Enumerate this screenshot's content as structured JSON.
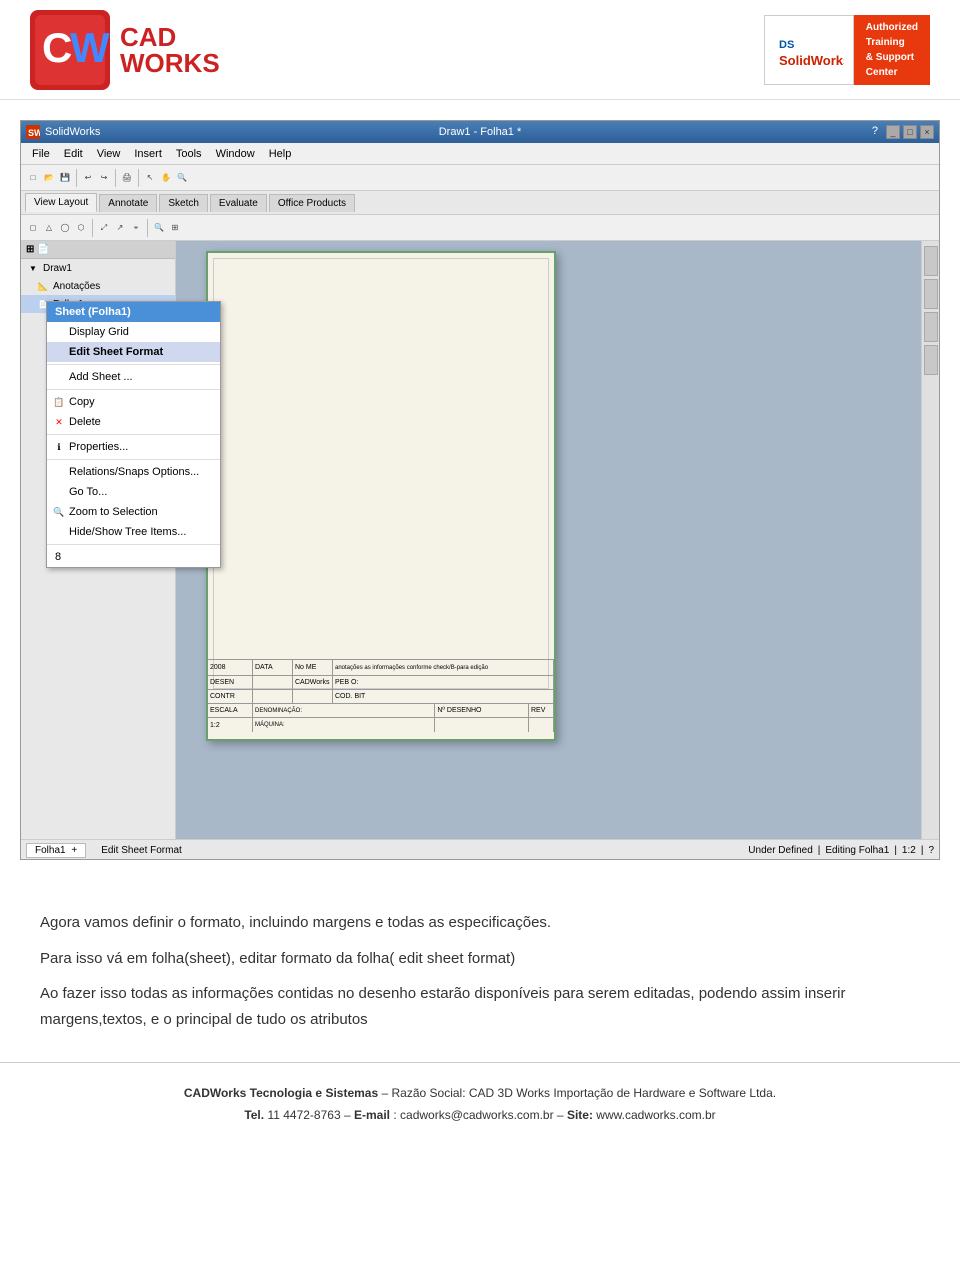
{
  "header": {
    "logo_text_line1": "CAD",
    "logo_text_line2": "WORKS",
    "solidworks_label": "SolidWorks",
    "authorized_line1": "Authorized",
    "authorized_line2": "Training",
    "authorized_line3": "& Support",
    "authorized_line4": "Center"
  },
  "solidworks_app": {
    "title": "Draw1 - Folha1 *",
    "app_name": "SolidWorks",
    "menu_items": [
      "View Layout",
      "Annotate",
      "Sketch",
      "Evaluate",
      "Office Products"
    ],
    "tabs": {
      "labels": [
        "View Layout",
        "Annotate",
        "Sketch",
        "Evaluate",
        "Office Products"
      ]
    },
    "tree": {
      "draw_label": "Draw1",
      "annotations_label": "Anotações",
      "sheet_label": "Sheet (Folha1)"
    },
    "context_menu": {
      "header": "Sheet (Folha1)",
      "items": [
        {
          "label": "Display Grid",
          "icon": ""
        },
        {
          "label": "Edit Sheet Format",
          "icon": ""
        },
        {
          "label": "Add Sheet ...",
          "icon": ""
        },
        {
          "label": "Copy",
          "icon": "copy"
        },
        {
          "label": "Delete",
          "icon": "x"
        },
        {
          "label": "Properties...",
          "icon": "props"
        },
        {
          "label": "Relations/Snaps Options...",
          "icon": ""
        },
        {
          "label": "Go To...",
          "icon": ""
        },
        {
          "label": "Zoom to Selection",
          "icon": "zoom"
        },
        {
          "label": "Hide/Show Tree Items...",
          "icon": ""
        },
        {
          "label": "8",
          "icon": ""
        }
      ]
    },
    "titleblock": {
      "row1": [
        "2008",
        "DATA",
        "No ME",
        "anotações as informações conforme check/B-para edição"
      ],
      "row2": [
        "DESEN",
        "",
        "CADWorks",
        "PEB O:"
      ],
      "row3": [
        "CONTR",
        "",
        "",
        "COD. BIT"
      ],
      "row4": [
        "ESCALA",
        "DENOMINAÇÃO:",
        "",
        "Nº DESENHO",
        "REV"
      ],
      "row5": [
        "1:2",
        "MÁQUINA:",
        "",
        "",
        ""
      ]
    },
    "status": {
      "sheet_tab": "Folha1",
      "status_text": "Edit Sheet Format",
      "right_status": "Under Defined",
      "editing": "Editing Folha1",
      "scale": "1:2"
    }
  },
  "body_text": {
    "paragraph1": "Agora vamos definir o formato, incluindo margens e todas as especificações.",
    "paragraph2": "Para isso vá em folha(sheet), editar formato da folha( edit sheet format)",
    "paragraph3": "Ao fazer isso todas as informações contidas no desenho estarão disponíveis para serem editadas, podendo assim inserir margens,textos, e o principal de tudo os atributos"
  },
  "footer": {
    "company": "CADWorks Tecnologia e Sistemas",
    "razao": "Razão Social: CAD 3D Works Importação de Hardware e Software Ltda.",
    "tel_label": "Tel.",
    "tel": "11 4472-8763",
    "email_label": "E-mail",
    "email": "cadworks@cadworks.com.br",
    "site_label": "Site:",
    "site": "www.cadworks.com.br"
  }
}
